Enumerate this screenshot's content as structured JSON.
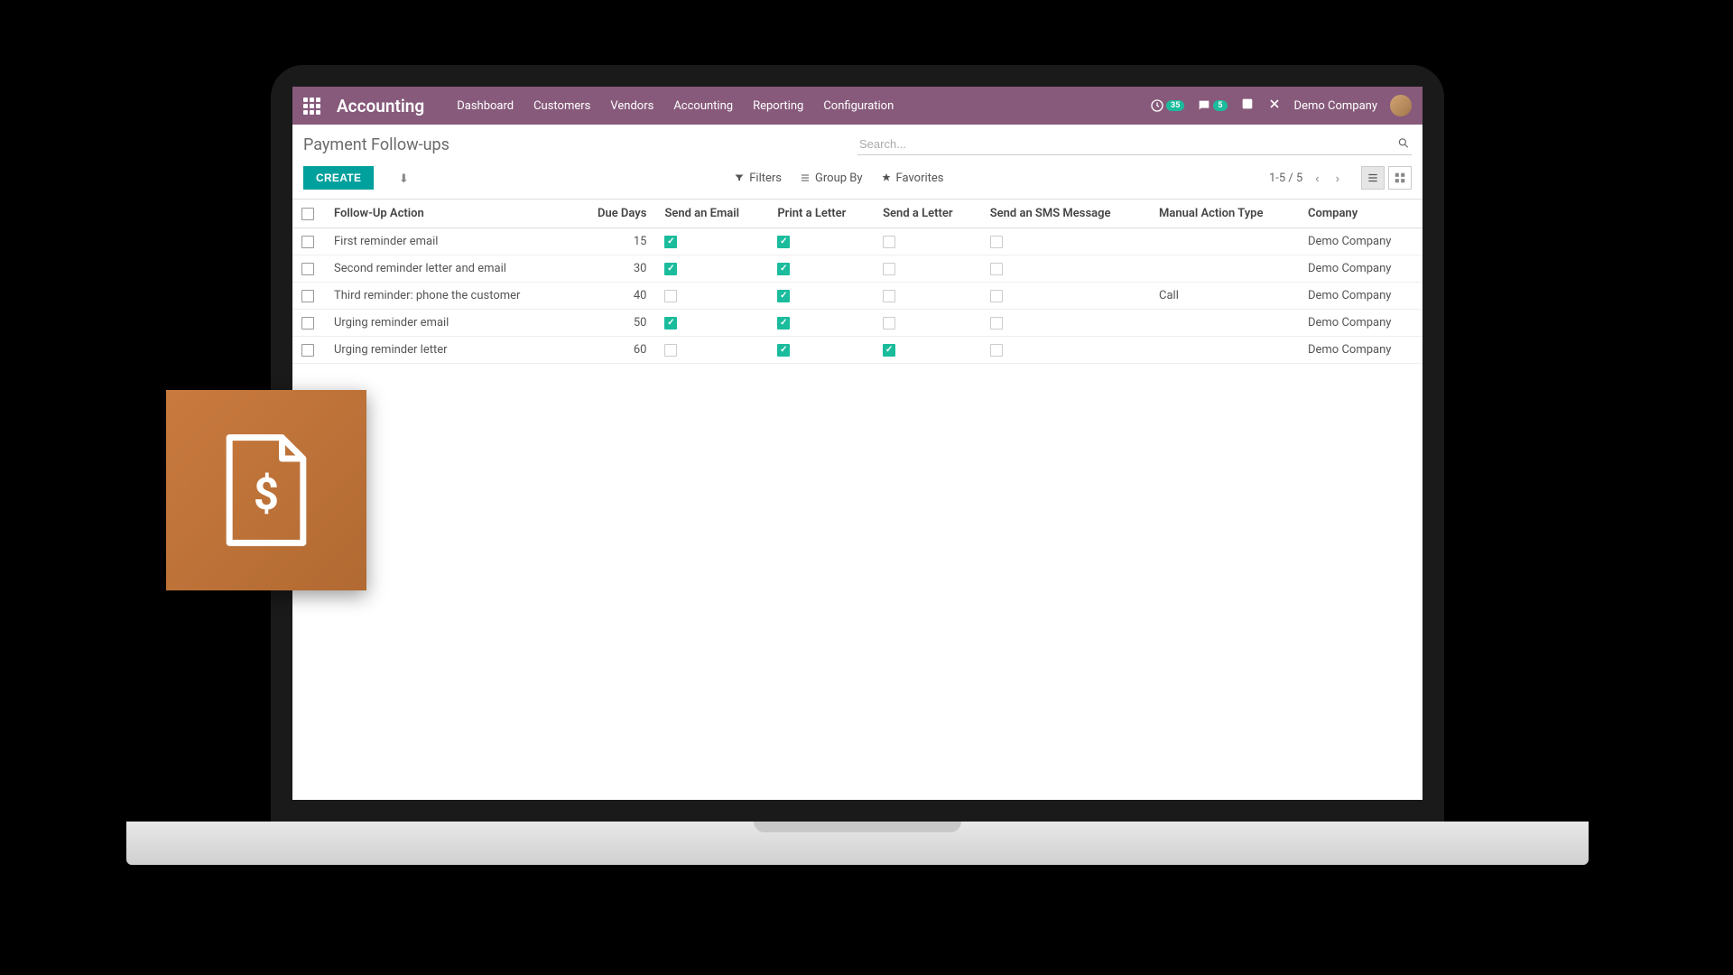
{
  "header": {
    "app_name": "Accounting",
    "nav": [
      "Dashboard",
      "Customers",
      "Vendors",
      "Accounting",
      "Reporting",
      "Configuration"
    ],
    "badge1": "35",
    "badge2": "5",
    "company": "Demo Company"
  },
  "page": {
    "title": "Payment Follow-ups",
    "search_placeholder": "Search...",
    "create_label": "CREATE",
    "filters_label": "Filters",
    "groupby_label": "Group By",
    "favorites_label": "Favorites",
    "pager": "1-5 / 5"
  },
  "table": {
    "headers": {
      "action": "Follow-Up Action",
      "due_days": "Due Days",
      "send_email": "Send an Email",
      "print_letter": "Print a Letter",
      "send_letter": "Send a Letter",
      "send_sms": "Send an SMS Message",
      "manual_action": "Manual Action Type",
      "company": "Company"
    },
    "rows": [
      {
        "action": "First reminder email",
        "due_days": "15",
        "send_email": true,
        "print_letter": true,
        "send_letter": false,
        "send_sms": false,
        "manual_action": "",
        "company": "Demo Company"
      },
      {
        "action": "Second reminder letter and email",
        "due_days": "30",
        "send_email": true,
        "print_letter": true,
        "send_letter": false,
        "send_sms": false,
        "manual_action": "",
        "company": "Demo Company"
      },
      {
        "action": "Third reminder: phone the customer",
        "due_days": "40",
        "send_email": false,
        "print_letter": true,
        "send_letter": false,
        "send_sms": false,
        "manual_action": "Call",
        "company": "Demo Company"
      },
      {
        "action": "Urging reminder email",
        "due_days": "50",
        "send_email": true,
        "print_letter": true,
        "send_letter": false,
        "send_sms": false,
        "manual_action": "",
        "company": "Demo Company"
      },
      {
        "action": "Urging reminder letter",
        "due_days": "60",
        "send_email": false,
        "print_letter": true,
        "send_letter": true,
        "send_sms": false,
        "manual_action": "",
        "company": "Demo Company"
      }
    ]
  }
}
